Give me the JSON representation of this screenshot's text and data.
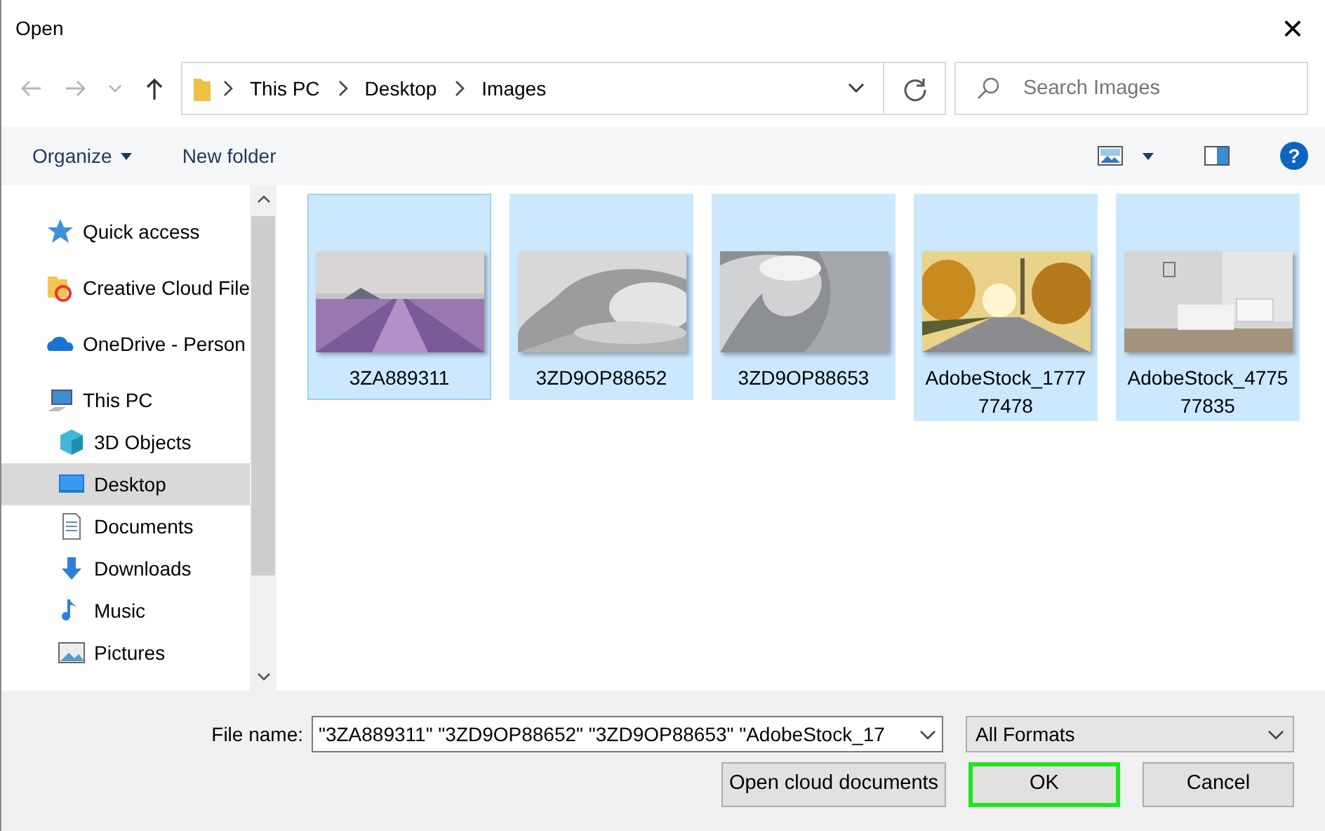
{
  "window": {
    "title": "Open",
    "close": "×"
  },
  "navigation": {
    "back_enabled": false,
    "forward_enabled": false,
    "up_enabled": true
  },
  "breadcrumb": [
    "This PC",
    "Desktop",
    "Images"
  ],
  "search": {
    "placeholder": "Search Images"
  },
  "toolbar": {
    "organize": "Organize",
    "new_folder": "New folder",
    "help": "?"
  },
  "sidebar": {
    "items": [
      {
        "label": "Quick access",
        "kind": "star",
        "selected": false
      },
      {
        "label": "Creative Cloud File",
        "kind": "cloudfolder",
        "selected": false
      },
      {
        "label": "OneDrive - Person",
        "kind": "onedrive",
        "selected": false
      },
      {
        "label": "This PC",
        "kind": "pc",
        "selected": false,
        "children": [
          {
            "label": "3D Objects",
            "kind": "cube",
            "selected": false
          },
          {
            "label": "Desktop",
            "kind": "desktop",
            "selected": true
          },
          {
            "label": "Documents",
            "kind": "document",
            "selected": false
          },
          {
            "label": "Downloads",
            "kind": "download",
            "selected": false
          },
          {
            "label": "Music",
            "kind": "music",
            "selected": false
          },
          {
            "label": "Pictures",
            "kind": "pictures",
            "selected": false
          }
        ]
      }
    ]
  },
  "files": [
    {
      "name": "3ZA889311",
      "selected": true,
      "focused": true,
      "kind": "picture"
    },
    {
      "name": "3ZD9OP88652",
      "selected": true,
      "focused": false,
      "kind": "picture"
    },
    {
      "name": "3ZD9OP88653",
      "selected": true,
      "focused": false,
      "kind": "picture"
    },
    {
      "name": "AdobeStock_177777478",
      "selected": true,
      "focused": false,
      "kind": "picture"
    },
    {
      "name": "AdobeStock_477577835",
      "selected": true,
      "focused": false,
      "kind": "picture"
    }
  ],
  "footer": {
    "file_name_label": "File name:",
    "file_name_value": "\"3ZA889311\" \"3ZD9OP88652\" \"3ZD9OP88653\" \"AdobeStock_17",
    "file_type": "All Formats",
    "buttons": [
      {
        "label": "Open cloud documents",
        "highlighted": false
      },
      {
        "label": "OK",
        "highlighted": true
      },
      {
        "label": "Cancel",
        "highlighted": false
      }
    ]
  }
}
